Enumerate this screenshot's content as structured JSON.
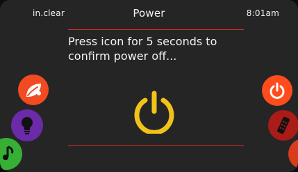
{
  "status_bar": {
    "brand": "in.clear",
    "title": "Power",
    "time": "8:01am"
  },
  "dialog": {
    "message": "Press icon for 5 seconds to confirm power off..."
  },
  "icons": {
    "main": "power-icon",
    "left": [
      "leaf-icon",
      "light-bulb-icon",
      "music-note-icon"
    ],
    "right": [
      "power-icon",
      "remote-control-icon",
      "partial-icon"
    ]
  },
  "colors": {
    "background": "#252525",
    "accent_line": "#d82a20",
    "power_main": "#f2c21a",
    "leaf_button": "#f24a22",
    "bulb_button": "#6b2aa8",
    "music_button": "#36b034",
    "power_button": "#ff4c1c",
    "remote_button": "#a91c18"
  }
}
